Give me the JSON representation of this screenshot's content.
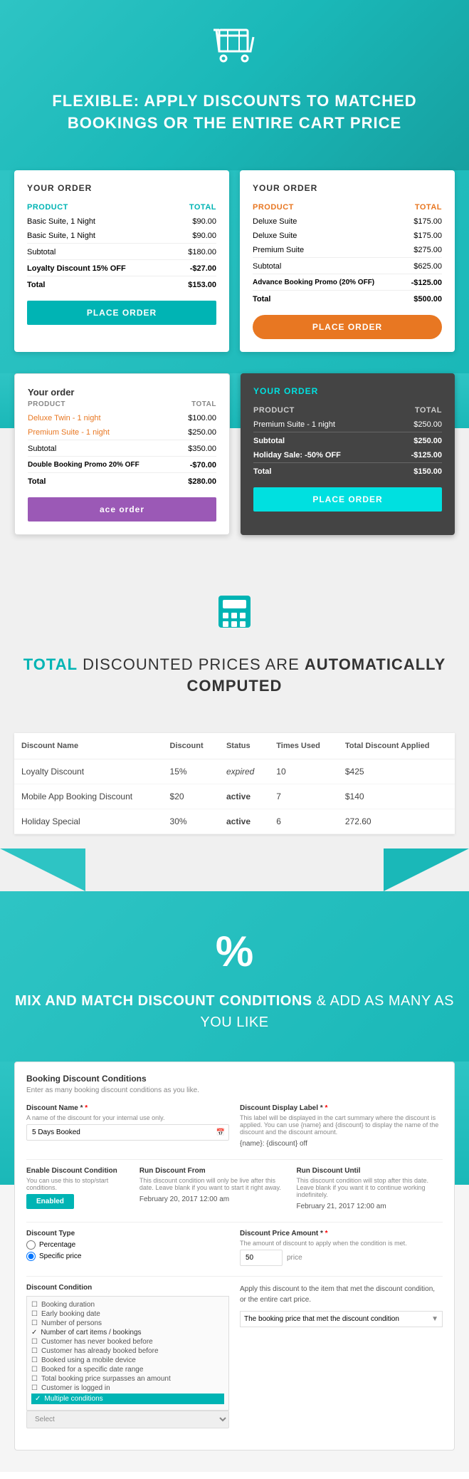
{
  "hero": {
    "title_flexible": "FLEXIBLE",
    "title_rest": ": APPLY DISCOUNTS TO MATCHED BOOKINGS OR THE ENTIRE CART PRICE"
  },
  "card1": {
    "title": "YOUR ORDER",
    "col_product": "PRODUCT",
    "col_total": "TOTAL",
    "rows": [
      {
        "product": "Basic Suite, 1 Night",
        "total": "$90.00"
      },
      {
        "product": "Basic Suite, 1 Night",
        "total": "$90.00"
      }
    ],
    "subtotal_label": "Subtotal",
    "subtotal_value": "$180.00",
    "discount_label": "Loyalty Discount 15% OFF",
    "discount_value": "-$27.00",
    "total_label": "Total",
    "total_value": "$153.00",
    "btn_label": "PLACE ORDER"
  },
  "card2": {
    "title": "YOUR ORDER",
    "col_product": "PRODUCT",
    "col_total": "TOTAL",
    "rows": [
      {
        "product": "Deluxe Suite",
        "total": "$175.00"
      },
      {
        "product": "Deluxe Suite",
        "total": "$175.00"
      },
      {
        "product": "Premium Suite",
        "total": "$275.00"
      }
    ],
    "subtotal_label": "Subtotal",
    "subtotal_value": "$625.00",
    "discount_label": "Advance Booking Promo (20% OFF)",
    "discount_value": "-$125.00",
    "total_label": "Total",
    "total_value": "$500.00",
    "btn_label": "PLACE ORDER"
  },
  "card3": {
    "title": "Your order",
    "col_product": "PRODUCT",
    "col_total": "TOTAL",
    "rows": [
      {
        "product": "Deluxe Twin - 1 night",
        "total": "$100.00"
      },
      {
        "product": "Premium Suite - 1 night",
        "total": "$250.00"
      }
    ],
    "subtotal_label": "Subtotal",
    "subtotal_value": "$350.00",
    "discount_label": "Double Booking Promo 20% OFF",
    "discount_value": "-$70.00",
    "total_label": "Total",
    "total_value": "$280.00",
    "btn_label": "ace order"
  },
  "card4": {
    "title": "YOUR ORDER",
    "col_product": "PRODUCT",
    "col_total": "TOTAL",
    "rows": [
      {
        "product": "Premium Suite - 1 night",
        "total": "$250.00"
      }
    ],
    "subtotal_label": "Subtotal",
    "subtotal_value": "$250.00",
    "discount_label": "Holiday Sale: -50% OFF",
    "discount_value": "-$125.00",
    "total_label": "Total",
    "total_value": "$150.00",
    "btn_label": "PLACE ORDER"
  },
  "calc": {
    "title_total": "TOTAL",
    "title_rest": " DISCOUNTED PRICES ARE ",
    "title_bold": "AUTOMATICALLY COMPUTED"
  },
  "discount_table": {
    "headers": [
      "Discount Name",
      "Discount",
      "Status",
      "Times Used",
      "Total Discount Applied"
    ],
    "rows": [
      {
        "name": "Loyalty Discount",
        "discount": "15%",
        "status": "expired",
        "times_used": "10",
        "total": "$425"
      },
      {
        "name": "Mobile App Booking Discount",
        "discount": "$20",
        "status": "active",
        "times_used": "7",
        "total": "$140"
      },
      {
        "name": "Holiday Special",
        "discount": "30%",
        "status": "active",
        "times_used": "6",
        "total": "272.60"
      }
    ]
  },
  "percent": {
    "title_strong": "MIX AND MATCH DISCOUNT CONDITIONS",
    "title_rest": " & ADD AS MANY AS YOU LIKE"
  },
  "conditions_form": {
    "title": "Booking Discount Conditions",
    "subtitle": "Enter as many booking discount conditions as you like.",
    "discount_name_label": "Discount Name *",
    "discount_name_sublabel": "A name of the discount for your internal use only.",
    "discount_name_value": "5 Days Booked",
    "display_label": "Discount Display Label *",
    "display_sublabel": "This label will be displayed in the cart summary where the discount is applied. You can use {name} and {discount} to display the name of the discount and the discount amount.",
    "display_value": "{name}: {discount} off",
    "enable_label": "Enable Discount Condition",
    "enable_sublabel": "You can use this to stop/start conditions.",
    "enable_btn": "Enabled",
    "run_from_label": "Run Discount From",
    "run_from_sublabel": "This discount condition will only be live after this date. Leave blank if you want to start it right away.",
    "run_from_value": "February 20, 2017 12:00 am",
    "run_until_label": "Run Discount Until",
    "run_until_sublabel": "This discount condition will stop after this date. Leave blank if you want it to continue working indefinitely.",
    "run_until_value": "February 21, 2017 12:00 am",
    "discount_type_label": "Discount Type",
    "type_percentage": "Percentage",
    "type_specific": "Specific price",
    "type_selected": "specific",
    "discount_price_label": "Discount Price Amount *",
    "discount_price_sublabel": "The amount of discount to apply when the condition is met.",
    "discount_price_value": "50",
    "discount_price_unit": "price",
    "discount_condition_label": "Discount Condition",
    "conditions_list": [
      {
        "label": "Booking duration",
        "checked": false
      },
      {
        "label": "Early booking date",
        "checked": false
      },
      {
        "label": "Number of persons",
        "checked": false
      },
      {
        "label": "Number of cart items / bookings",
        "checked": true
      },
      {
        "label": "Customer has never booked before",
        "checked": false
      },
      {
        "label": "Customer has already booked before",
        "checked": false
      },
      {
        "label": "Booked using a mobile device",
        "checked": false
      },
      {
        "label": "Booked for a specific date range",
        "checked": false
      },
      {
        "label": "Total booking price surpasses an amount",
        "checked": false
      },
      {
        "label": "Customer is logged in",
        "checked": false
      },
      {
        "label": "Multiple conditions",
        "checked": false,
        "selected": true
      }
    ],
    "apply_to_label": "Apply this discount to the item that met the discount condition, or the entire cart price.",
    "select_placeholder": "Select",
    "apply_dropdown_label": "The booking price that met the discount condition"
  }
}
